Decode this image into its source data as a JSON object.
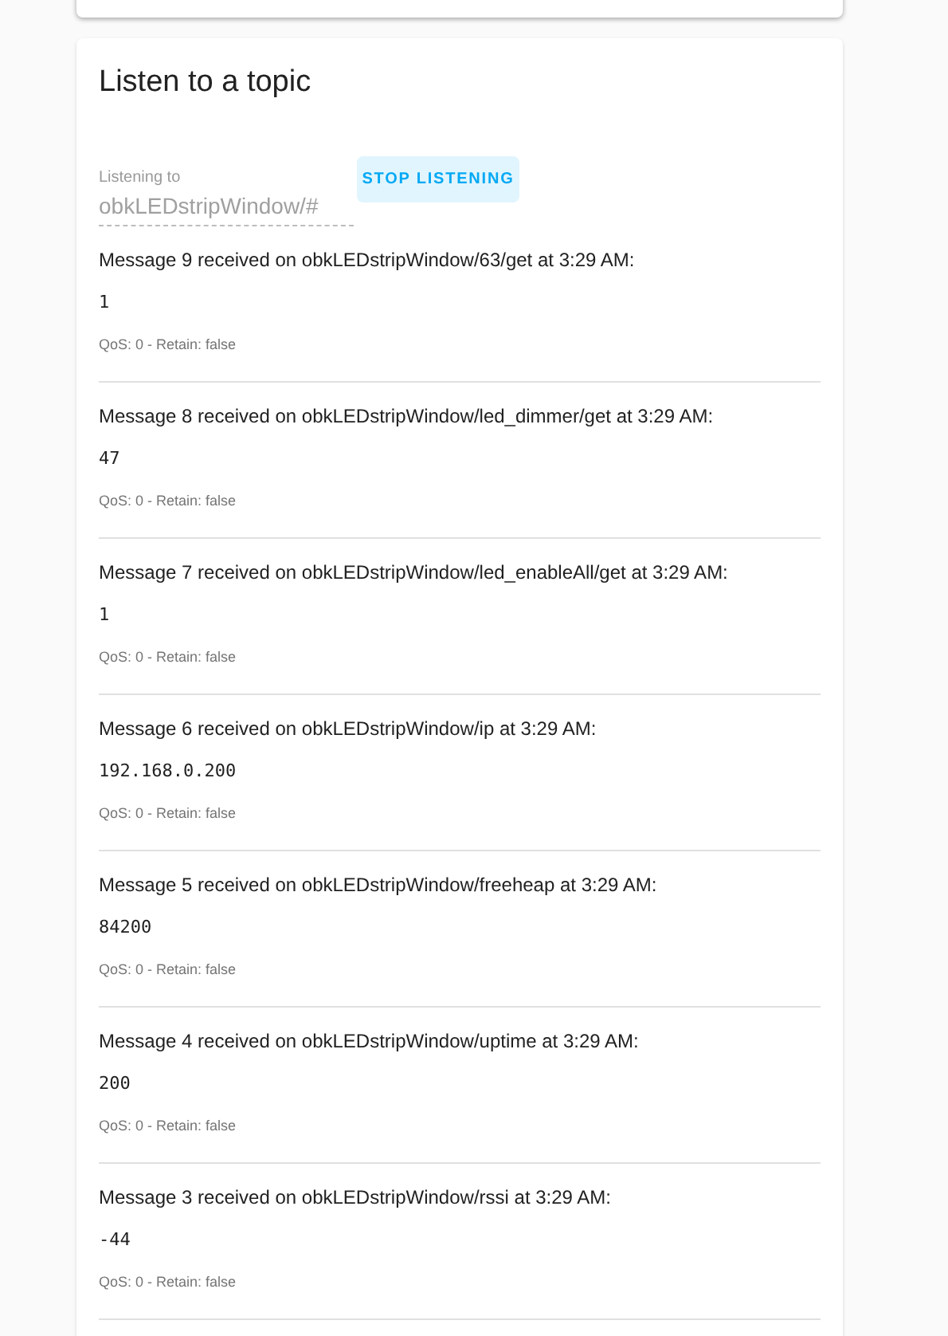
{
  "title": "Listen to a topic",
  "topic_field": {
    "label": "Listening to",
    "value": "obkLEDstripWindow/#",
    "disabled": true
  },
  "stop_button": {
    "label": "STOP LISTENING"
  },
  "messages": [
    {
      "heading": "Message 9 received on obkLEDstripWindow/63/get at 3:29 AM:",
      "payload": "1",
      "meta": "QoS: 0 - Retain: false"
    },
    {
      "heading": "Message 8 received on obkLEDstripWindow/led_dimmer/get at 3:29 AM:",
      "payload": "47",
      "meta": "QoS: 0 - Retain: false"
    },
    {
      "heading": "Message 7 received on obkLEDstripWindow/led_enableAll/get at 3:29 AM:",
      "payload": "1",
      "meta": "QoS: 0 - Retain: false"
    },
    {
      "heading": "Message 6 received on obkLEDstripWindow/ip at 3:29 AM:",
      "payload": "192.168.0.200",
      "meta": "QoS: 0 - Retain: false"
    },
    {
      "heading": "Message 5 received on obkLEDstripWindow/freeheap at 3:29 AM:",
      "payload": "84200",
      "meta": "QoS: 0 - Retain: false"
    },
    {
      "heading": "Message 4 received on obkLEDstripWindow/uptime at 3:29 AM:",
      "payload": "200",
      "meta": "QoS: 0 - Retain: false"
    },
    {
      "heading": "Message 3 received on obkLEDstripWindow/rssi at 3:29 AM:",
      "payload": "-44",
      "meta": "QoS: 0 - Retain: false"
    }
  ]
}
